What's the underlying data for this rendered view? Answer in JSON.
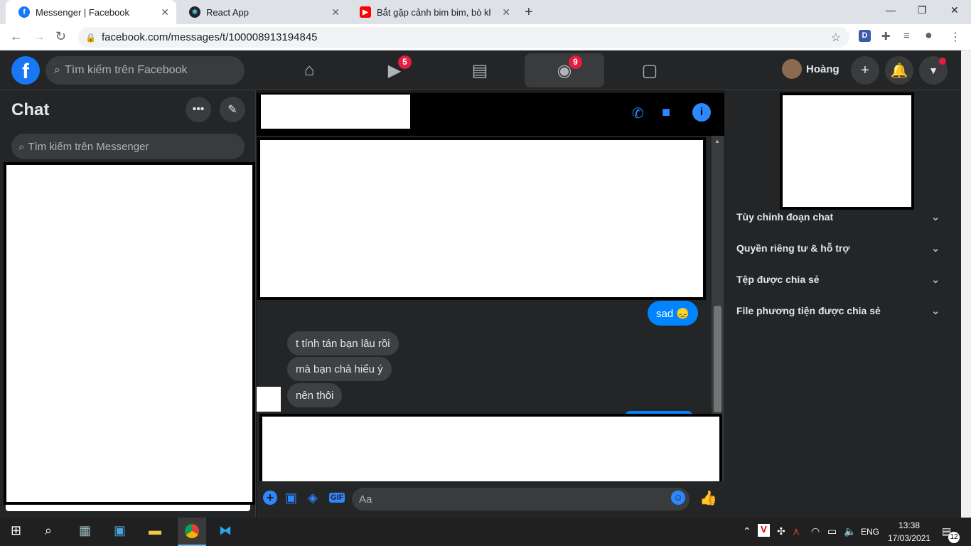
{
  "browser": {
    "tabs": [
      {
        "title": "Messenger | Facebook"
      },
      {
        "title": "React App"
      },
      {
        "title": "Bắt gặp cảnh bim bim, bò khô ph"
      }
    ],
    "url": "facebook.com/messages/t/100008913194845"
  },
  "fbnav": {
    "search_placeholder": "Tìm kiếm trên Facebook",
    "watch_badge": "5",
    "groups_badge": "9",
    "profile_name": "Hoàng"
  },
  "chatlist": {
    "title": "Chat",
    "search_placeholder": "Tìm kiếm trên Messenger"
  },
  "conversation": {
    "messages": [
      {
        "text": "sad 😞",
        "direction": "out"
      },
      {
        "text": "t tính tán bạn lâu rồi",
        "direction": "in"
      },
      {
        "text": "mà bạn chả hiểu ý",
        "direction": "in"
      },
      {
        "text": "nên thôi",
        "direction": "in"
      }
    ],
    "composer_placeholder": "Aa"
  },
  "info_panel": {
    "sections": [
      {
        "label": "Tùy chỉnh đoạn chat"
      },
      {
        "label": "Quyền riêng tư & hỗ trợ"
      },
      {
        "label": "Tệp được chia sẻ"
      },
      {
        "label": "File phương tiện được chia sẻ"
      }
    ]
  },
  "taskbar": {
    "language": "ENG",
    "time": "13:38",
    "date": "17/03/2021",
    "notifications": "12"
  },
  "colors": {
    "fb_blue": "#1877f2",
    "messenger_blue": "#0084ff",
    "badge_red": "#e41e3f",
    "dark_bg": "#242526"
  }
}
